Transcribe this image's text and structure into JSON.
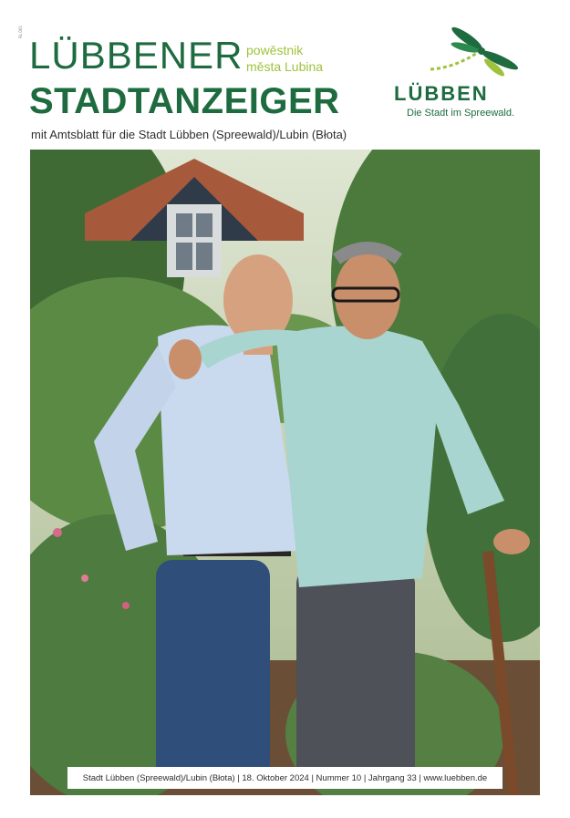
{
  "masthead": {
    "name_line1": "LÜBBENER",
    "name_line2": "STADTANZEIGER",
    "sorbian_line1": "powěstnik",
    "sorbian_line2": "města Lubina",
    "subtitle": "mit Amtsblatt für die Stadt Lübben (Spreewald)/Lubin (Błota)"
  },
  "logo": {
    "icon": "dragonfly-icon",
    "wordmark": "LÜBBEN",
    "tagline": "Die Stadt im Spreewald."
  },
  "side_mark": "RL 001",
  "cover_photo": {
    "description_icon": "cover-photo"
  },
  "footer": {
    "text": "Stadt Lübben (Spreewald)/Lubin (Błota) | 18. Oktober 2024 | Nummer 10 | Jahrgang 33 | www.luebben.de"
  },
  "colors": {
    "brand_green": "#1d6b3f",
    "accent_lime": "#9ec23c"
  }
}
